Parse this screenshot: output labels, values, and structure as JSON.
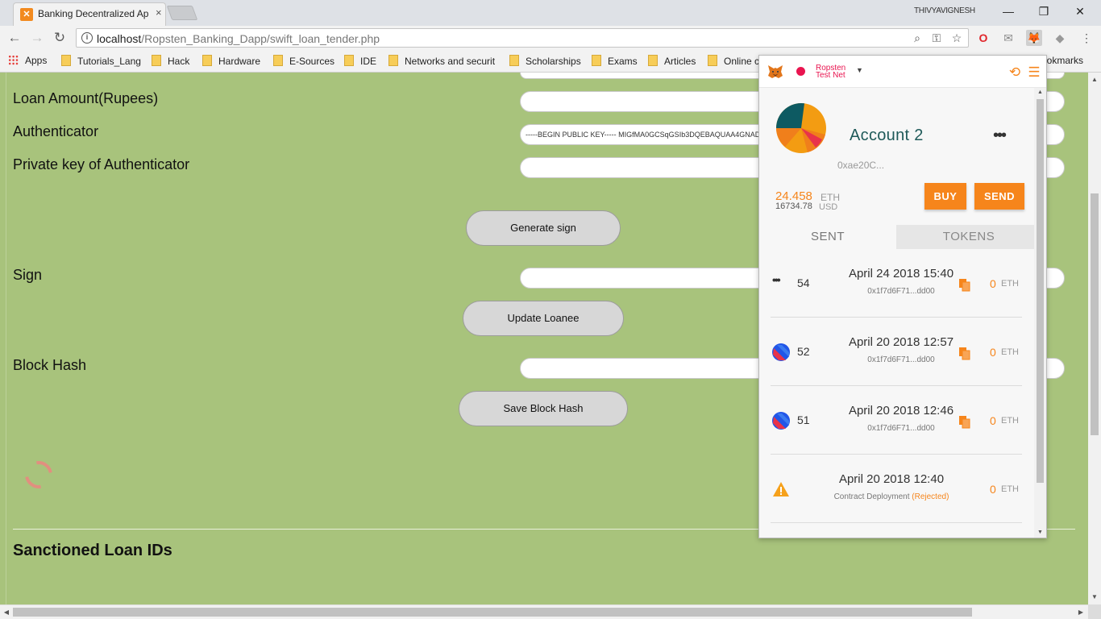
{
  "browser": {
    "tab_title": "Banking Decentralized Ap",
    "tab_close": "×",
    "window_user": "THIVYAVIGNESH",
    "minimize": "—",
    "restore": "❐",
    "close": "✕",
    "url_host": "localhost",
    "url_path": "/Ropsten_Banking_Dapp/swift_loan_tender.php",
    "bookmarks": [
      "Apps",
      "Tutorials_Lang",
      "Hack",
      "Hardware",
      "E-Sources",
      "IDE",
      "Networks and securit",
      "Scholarships",
      "Exams",
      "Articles",
      "Online c",
      "Bookmarks"
    ]
  },
  "form": {
    "fields": [
      {
        "label": "Loan Amount(Rupees)",
        "value": ""
      },
      {
        "label": "Authenticator",
        "value": "-----BEGIN PUBLIC KEY----- MIGfMA0GCSqGSIb3DQEBAQUAA4GNADCBiQKBgQC yMj"
      },
      {
        "label": "Private key of Authenticator",
        "value": ""
      },
      {
        "label": "Sign",
        "value": ""
      },
      {
        "label": "Block Hash",
        "value": ""
      }
    ],
    "buttons": {
      "generate_sign": "Generate sign",
      "update_loanee": "Update Loanee",
      "save_block_hash": "Save Block Hash"
    },
    "section_title": "Sanctioned Loan IDs"
  },
  "metamask": {
    "network_line1": "Ropsten",
    "network_line2": "Test Net",
    "account_name": "Account 2",
    "account_menu": "•••",
    "address": "0xae20C...",
    "eth_balance": "24.458",
    "eth_unit": "ETH",
    "usd_balance": "16734.78",
    "usd_unit": "USD",
    "buy_label": "BUY",
    "send_label": "SEND",
    "tabs": [
      "SENT",
      "TOKENS"
    ],
    "transactions": [
      {
        "nonce": "54",
        "date": "April 24 2018 15:40",
        "hash": "0x1f7d6F71...dd00",
        "amount": "0",
        "unit": "ETH",
        "status": "pending"
      },
      {
        "nonce": "52",
        "date": "April 20 2018 12:57",
        "hash": "0x1f7d6F71...dd00",
        "amount": "0",
        "unit": "ETH",
        "status": "confirmed"
      },
      {
        "nonce": "51",
        "date": "April 20 2018 12:46",
        "hash": "0x1f7d6F71...dd00",
        "amount": "0",
        "unit": "ETH",
        "status": "confirmed"
      },
      {
        "nonce": "",
        "date": "April 20 2018 12:40",
        "hash": "Contract Deployment",
        "status_note": "(Rejected)",
        "amount": "0",
        "unit": "ETH",
        "status": "rejected"
      }
    ],
    "colors": {
      "accent": "#f6851b",
      "network": "#e91550",
      "account_name": "#1f5a59"
    }
  },
  "page": {
    "background": "#a8c37c"
  }
}
